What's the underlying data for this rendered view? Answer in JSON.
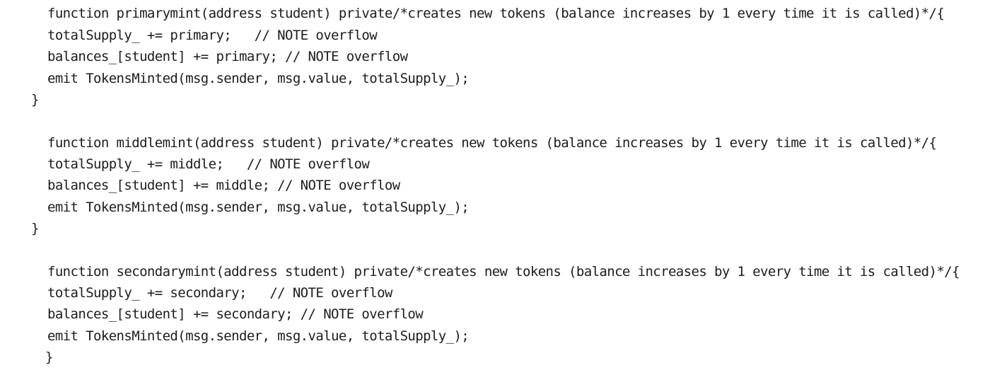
{
  "code": {
    "lines": [
      "function primarymint(address student) private/*creates new tokens (balance increases by 1 every time it is called)*/{",
      "totalSupply_ += primary;   // NOTE overflow",
      "balances_[student] += primary; // NOTE overflow",
      "emit TokensMinted(msg.sender, msg.value, totalSupply_);",
      "}",
      "function middlemint(address student) private/*creates new tokens (balance increases by 1 every time it is called)*/{",
      "totalSupply_ += middle;   // NOTE overflow",
      "balances_[student] += middle; // NOTE overflow",
      "emit TokensMinted(msg.sender, msg.value, totalSupply_);",
      "}",
      "function secondarymint(address student) private/*creates new tokens (balance increases by 1 every time it is called)*/{",
      "totalSupply_ += secondary;   // NOTE overflow",
      "balances_[student] += secondary; // NOTE overflow",
      "emit TokensMinted(msg.sender, msg.value, totalSupply_);",
      "}"
    ]
  }
}
